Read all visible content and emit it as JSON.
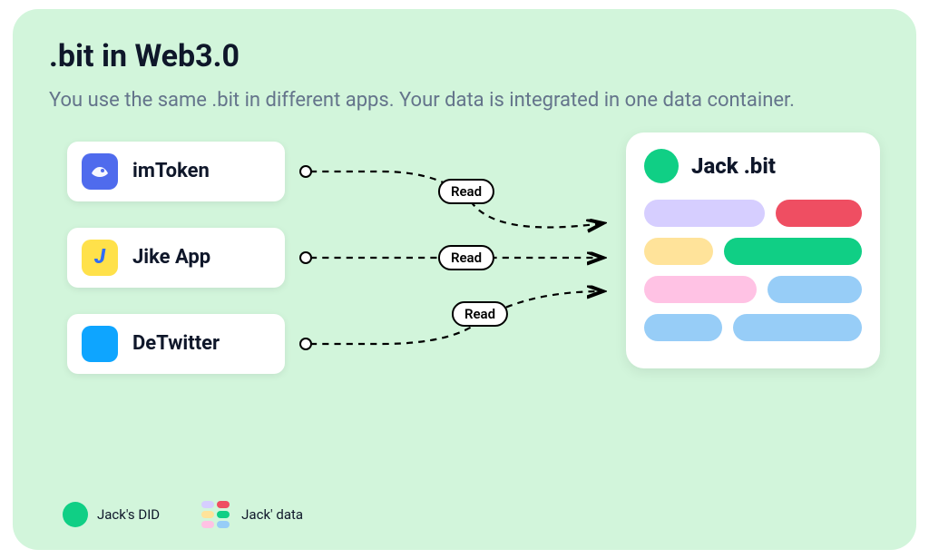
{
  "title": ".bit in Web3.0",
  "subtitle": "You use the same .bit in different apps. Your data is integrated in one data container.",
  "apps": [
    {
      "label": "imToken"
    },
    {
      "label": "Jike App"
    },
    {
      "label": "DeTwitter"
    }
  ],
  "edge_label": "Read",
  "container": {
    "name": "Jack .bit"
  },
  "legend": {
    "did": "Jack's DID",
    "data": "Jack' data"
  }
}
